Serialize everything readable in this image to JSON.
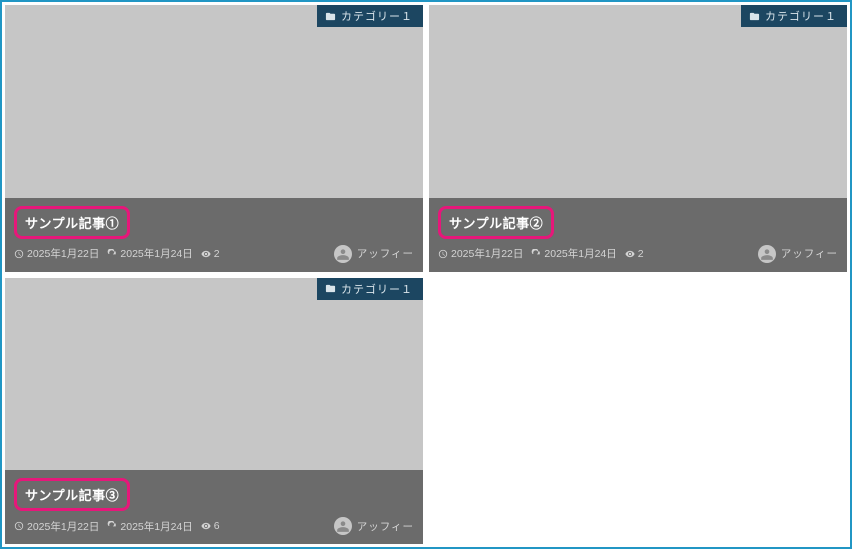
{
  "cards": [
    {
      "category": "カテゴリー１",
      "title": "サンプル記事①",
      "posted": "2025年1月22日",
      "updated": "2025年1月24日",
      "views": "2",
      "author": "アッフィー"
    },
    {
      "category": "カテゴリー１",
      "title": "サンプル記事②",
      "posted": "2025年1月22日",
      "updated": "2025年1月24日",
      "views": "2",
      "author": "アッフィー"
    },
    {
      "category": "カテゴリー１",
      "title": "サンプル記事③",
      "posted": "2025年1月22日",
      "updated": "2025年1月24日",
      "views": "6",
      "author": "アッフィー"
    }
  ]
}
